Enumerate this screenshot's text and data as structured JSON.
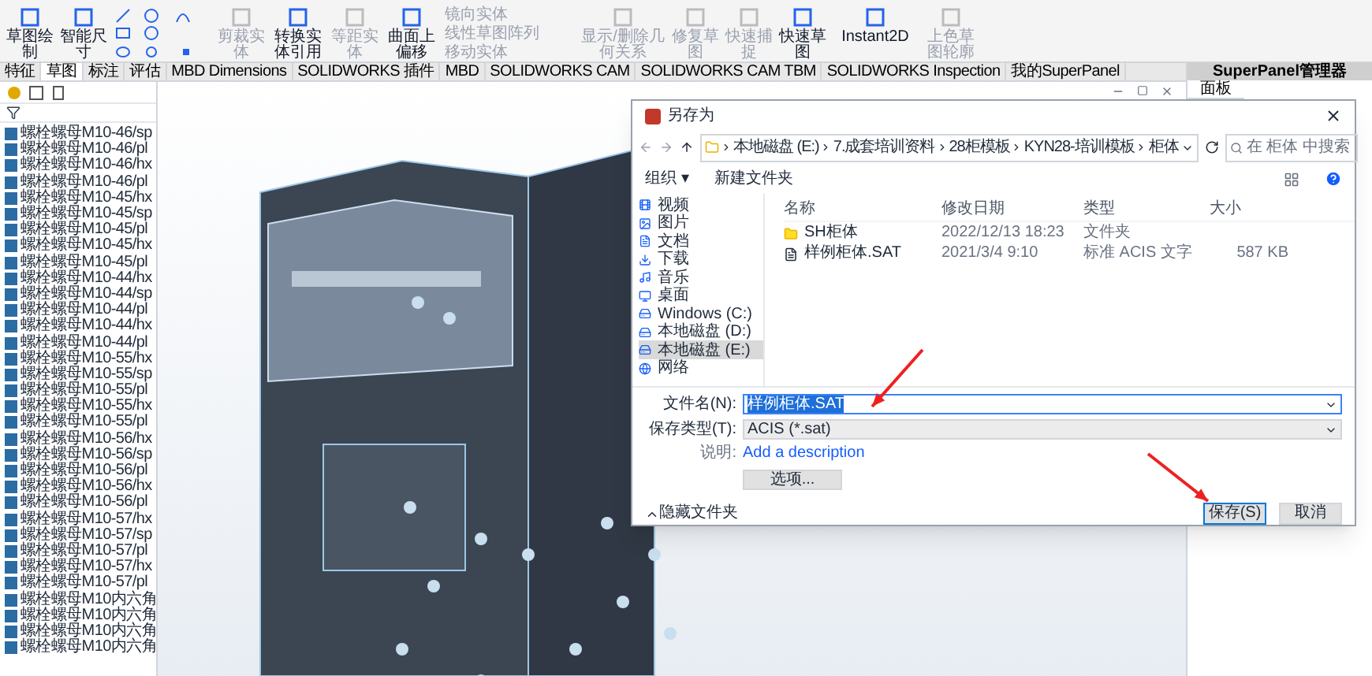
{
  "ribbon": [
    {
      "kind": "big",
      "label": "草图绘制",
      "disabled": false
    },
    {
      "kind": "big",
      "label": "智能尺寸",
      "disabled": false
    },
    {
      "kind": "tools"
    },
    {
      "kind": "big",
      "label": "剪裁实体",
      "disabled": true
    },
    {
      "kind": "big",
      "label": "转换实体引用",
      "disabled": false
    },
    {
      "kind": "big",
      "label": "等距实体",
      "disabled": true
    },
    {
      "kind": "big",
      "label": "曲面上偏移",
      "disabled": false
    },
    {
      "kind": "stack",
      "items": [
        {
          "label": "镜向实体",
          "disabled": true
        },
        {
          "label": "线性草图阵列",
          "disabled": true
        },
        {
          "label": "移动实体",
          "disabled": true
        }
      ]
    },
    {
      "kind": "big",
      "label": "显示/删除几何关系",
      "disabled": true
    },
    {
      "kind": "big",
      "label": "修复草图",
      "disabled": true
    },
    {
      "kind": "big",
      "label": "快速捕捉",
      "disabled": true
    },
    {
      "kind": "big",
      "label": "快速草图",
      "disabled": false
    },
    {
      "kind": "big",
      "label": "Instant2D",
      "disabled": false
    },
    {
      "kind": "big",
      "label": "上色草图轮廓",
      "disabled": true
    }
  ],
  "tabs": [
    {
      "label": "特征",
      "selected": false
    },
    {
      "label": "草图",
      "selected": true
    },
    {
      "label": "标注",
      "selected": false
    },
    {
      "label": "评估",
      "selected": false
    },
    {
      "label": "MBD Dimensions",
      "selected": false
    },
    {
      "label": "SOLIDWORKS 插件",
      "selected": false
    },
    {
      "label": "MBD",
      "selected": false
    },
    {
      "label": "SOLIDWORKS CAM",
      "selected": false
    },
    {
      "label": "SOLIDWORKS CAM TBM",
      "selected": false
    },
    {
      "label": "SOLIDWORKS Inspection",
      "selected": false
    },
    {
      "label": "我的SuperPanel",
      "selected": false
    }
  ],
  "tree": {
    "items": [
      "螺栓螺母M10-46/sp",
      "螺栓螺母M10-46/pl",
      "螺栓螺母M10-46/hx",
      "螺栓螺母M10-46/pl",
      "螺栓螺母M10-45/hx",
      "螺栓螺母M10-45/sp",
      "螺栓螺母M10-45/pl",
      "螺栓螺母M10-45/hx",
      "螺栓螺母M10-45/pl",
      "螺栓螺母M10-44/hx",
      "螺栓螺母M10-44/sp",
      "螺栓螺母M10-44/pl",
      "螺栓螺母M10-44/hx",
      "螺栓螺母M10-44/pl",
      "螺栓螺母M10-55/hx",
      "螺栓螺母M10-55/sp",
      "螺栓螺母M10-55/pl",
      "螺栓螺母M10-55/hx",
      "螺栓螺母M10-55/pl",
      "螺栓螺母M10-56/hx",
      "螺栓螺母M10-56/sp",
      "螺栓螺母M10-56/pl",
      "螺栓螺母M10-56/hx",
      "螺栓螺母M10-56/pl",
      "螺栓螺母M10-57/hx",
      "螺栓螺母M10-57/sp",
      "螺栓螺母M10-57/pl",
      "螺栓螺母M10-57/hx",
      "螺栓螺母M10-57/pl",
      "螺栓螺母M10内六角",
      "螺栓螺母M10内六角",
      "螺栓螺母M10内六角",
      "螺栓螺母M10内六角"
    ]
  },
  "right_panel": {
    "title": "SuperPanel管理器",
    "tab": "面板"
  },
  "dialog": {
    "title": "另存为",
    "path": [
      "本地磁盘 (E:)",
      "7.成套培训资料",
      "28柜模板",
      "KYN28-培训模板",
      "柜体"
    ],
    "search": {
      "placeholder": "在 柜体 中搜索"
    },
    "toolbar": [
      "组织 ▾",
      "新建文件夹"
    ],
    "nav": [
      {
        "label": "视频",
        "kind": "video",
        "selected": false
      },
      {
        "label": "图片",
        "kind": "picture",
        "selected": false
      },
      {
        "label": "文档",
        "kind": "document",
        "selected": false
      },
      {
        "label": "下载",
        "kind": "download",
        "selected": false
      },
      {
        "label": "音乐",
        "kind": "music",
        "selected": false
      },
      {
        "label": "桌面",
        "kind": "desktop",
        "selected": false
      },
      {
        "label": "Windows (C:)",
        "kind": "drive",
        "selected": false
      },
      {
        "label": "本地磁盘 (D:)",
        "kind": "drive",
        "selected": false
      },
      {
        "label": "本地磁盘 (E:)",
        "kind": "drive",
        "selected": true
      },
      {
        "label": "网络",
        "kind": "network",
        "selected": false
      }
    ],
    "columns": [
      "名称",
      "修改日期",
      "类型",
      "大小"
    ],
    "files": [
      {
        "kind": "folder",
        "name": "SH柜体",
        "date": "2022/12/13 18:23",
        "type": "文件夹"
      },
      {
        "kind": "file",
        "name": "样例柜体.SAT",
        "date": "2021/3/4 9:10",
        "type": "标准 ACIS 文字",
        "size": "587 KB"
      }
    ],
    "filename_label": "文件名(N):",
    "filename": "样例柜体.SAT",
    "type_label": "保存类型(T):",
    "type": "ACIS (*.sat)",
    "desc_label": "说明:",
    "desc_link": "Add a description",
    "options_button": "选项...",
    "hide_folders": "隐藏文件夹",
    "save": "保存(S)",
    "cancel": "取消"
  }
}
